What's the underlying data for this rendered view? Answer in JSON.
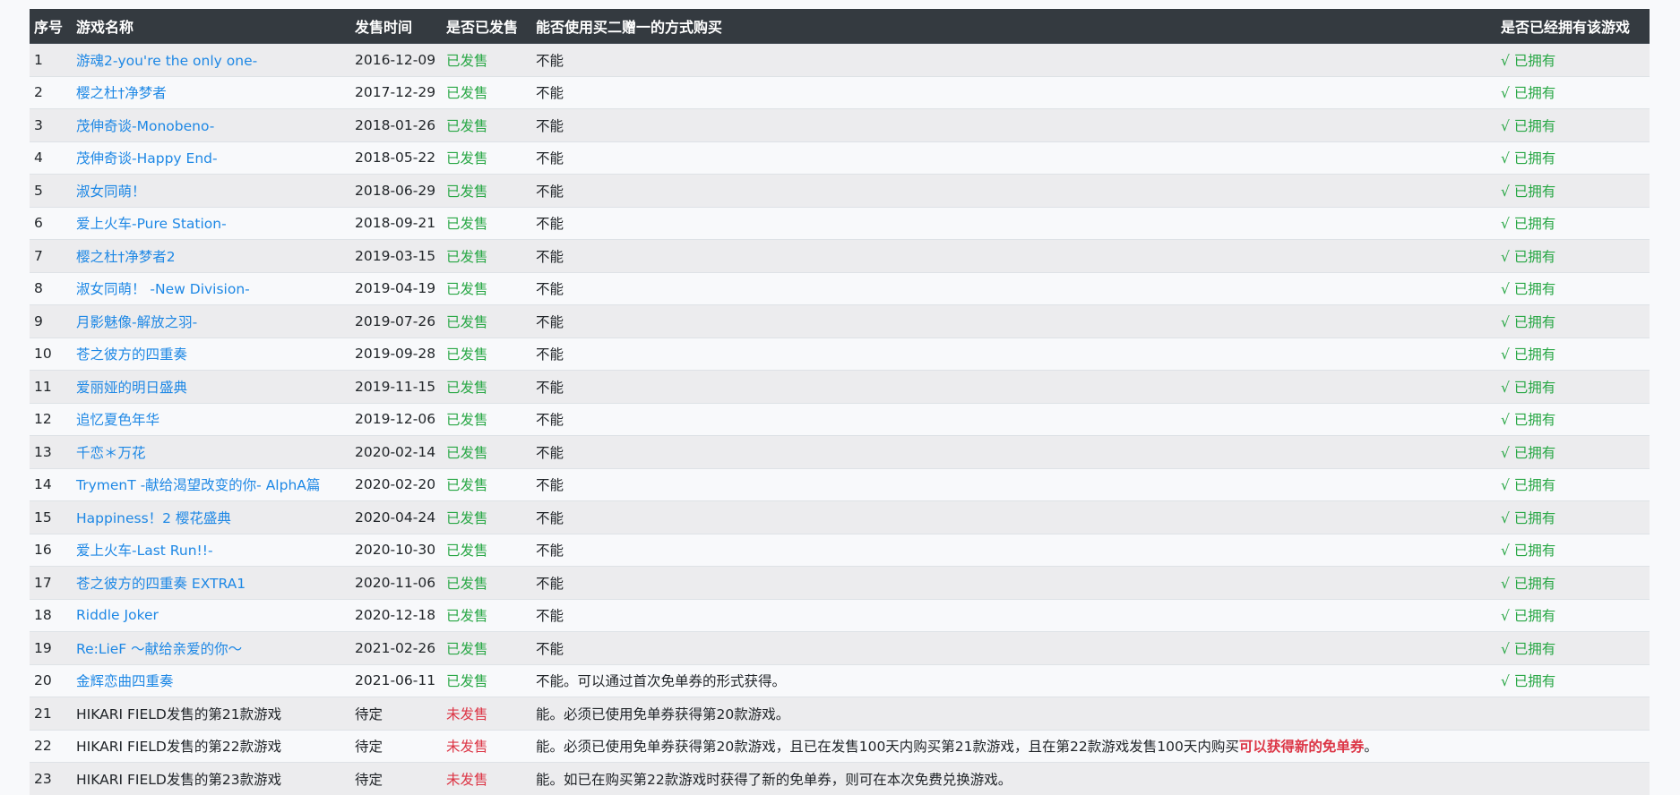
{
  "colors": {
    "header_bg": "#343a40",
    "link": "#1e88e5",
    "released": "#28a745",
    "unreleased": "#dc3545",
    "owned": "#28a745"
  },
  "table": {
    "headers": {
      "index": "序号",
      "name": "游戏名称",
      "date": "发售时间",
      "released": "是否已发售",
      "bogo": "能否使用买二赠一的方式购买",
      "owned": "是否已经拥有该游戏"
    },
    "rows": [
      {
        "index": "1",
        "name": "游魂2-you're the only one-",
        "link": true,
        "date": "2016-12-09",
        "status": "已发售",
        "released": true,
        "bogo": "不能",
        "owned": "√ 已拥有"
      },
      {
        "index": "2",
        "name": "樱之杜†净梦者",
        "link": true,
        "date": "2017-12-29",
        "status": "已发售",
        "released": true,
        "bogo": "不能",
        "owned": "√ 已拥有"
      },
      {
        "index": "3",
        "name": "茂伸奇谈-Monobeno-",
        "link": true,
        "date": "2018-01-26",
        "status": "已发售",
        "released": true,
        "bogo": "不能",
        "owned": "√ 已拥有"
      },
      {
        "index": "4",
        "name": "茂伸奇谈-Happy End-",
        "link": true,
        "date": "2018-05-22",
        "status": "已发售",
        "released": true,
        "bogo": "不能",
        "owned": "√ 已拥有"
      },
      {
        "index": "5",
        "name": "淑女同萌！",
        "link": true,
        "date": "2018-06-29",
        "status": "已发售",
        "released": true,
        "bogo": "不能",
        "owned": "√ 已拥有"
      },
      {
        "index": "6",
        "name": "爱上火车-Pure Station-",
        "link": true,
        "date": "2018-09-21",
        "status": "已发售",
        "released": true,
        "bogo": "不能",
        "owned": "√ 已拥有"
      },
      {
        "index": "7",
        "name": "樱之杜†净梦者2",
        "link": true,
        "date": "2019-03-15",
        "status": "已发售",
        "released": true,
        "bogo": "不能",
        "owned": "√ 已拥有"
      },
      {
        "index": "8",
        "name": "淑女同萌！ -New Division-",
        "link": true,
        "date": "2019-04-19",
        "status": "已发售",
        "released": true,
        "bogo": "不能",
        "owned": "√ 已拥有"
      },
      {
        "index": "9",
        "name": "月影魅像-解放之羽-",
        "link": true,
        "date": "2019-07-26",
        "status": "已发售",
        "released": true,
        "bogo": "不能",
        "owned": "√ 已拥有"
      },
      {
        "index": "10",
        "name": "苍之彼方的四重奏",
        "link": true,
        "date": "2019-09-28",
        "status": "已发售",
        "released": true,
        "bogo": "不能",
        "owned": "√ 已拥有"
      },
      {
        "index": "11",
        "name": "爱丽娅的明日盛典",
        "link": true,
        "date": "2019-11-15",
        "status": "已发售",
        "released": true,
        "bogo": "不能",
        "owned": "√ 已拥有"
      },
      {
        "index": "12",
        "name": "追忆夏色年华",
        "link": true,
        "date": "2019-12-06",
        "status": "已发售",
        "released": true,
        "bogo": "不能",
        "owned": "√ 已拥有"
      },
      {
        "index": "13",
        "name": "千恋＊万花",
        "link": true,
        "date": "2020-02-14",
        "status": "已发售",
        "released": true,
        "bogo": "不能",
        "owned": "√ 已拥有"
      },
      {
        "index": "14",
        "name": "TrymenT -献给渴望改变的你- AlphA篇",
        "link": true,
        "date": "2020-02-20",
        "status": "已发售",
        "released": true,
        "bogo": "不能",
        "owned": "√ 已拥有"
      },
      {
        "index": "15",
        "name": "Happiness！2 樱花盛典",
        "link": true,
        "date": "2020-04-24",
        "status": "已发售",
        "released": true,
        "bogo": "不能",
        "owned": "√ 已拥有"
      },
      {
        "index": "16",
        "name": "爱上火车-Last Run!!-",
        "link": true,
        "date": "2020-10-30",
        "status": "已发售",
        "released": true,
        "bogo": "不能",
        "owned": "√ 已拥有"
      },
      {
        "index": "17",
        "name": "苍之彼方的四重奏 EXTRA1",
        "link": true,
        "date": "2020-11-06",
        "status": "已发售",
        "released": true,
        "bogo": "不能",
        "owned": "√ 已拥有"
      },
      {
        "index": "18",
        "name": "Riddle Joker",
        "link": true,
        "date": "2020-12-18",
        "status": "已发售",
        "released": true,
        "bogo": "不能",
        "owned": "√ 已拥有"
      },
      {
        "index": "19",
        "name": "Re:LieF ～献给亲爱的你～",
        "link": true,
        "date": "2021-02-26",
        "status": "已发售",
        "released": true,
        "bogo": "不能",
        "owned": "√ 已拥有"
      },
      {
        "index": "20",
        "name": "金辉恋曲四重奏",
        "link": true,
        "date": "2021-06-11",
        "status": "已发售",
        "released": true,
        "bogo": "不能。可以通过首次免单券的形式获得。",
        "owned": "√ 已拥有"
      },
      {
        "index": "21",
        "name": "HIKARI FIELD发售的第21款游戏",
        "link": false,
        "date": "待定",
        "status": "未发售",
        "released": false,
        "bogo": "能。必须已使用免单券获得第20款游戏。",
        "owned": ""
      },
      {
        "index": "22",
        "name": "HIKARI FIELD发售的第22款游戏",
        "link": false,
        "date": "待定",
        "status": "未发售",
        "released": false,
        "bogo": "能。必须已使用免单券获得第20款游戏，且已在发售100天内购买第21款游戏，且在第22款游戏发售100天内购买",
        "bogo_highlight": "可以获得新的免单券",
        "bogo_tail": "。",
        "owned": ""
      },
      {
        "index": "23",
        "name": "HIKARI FIELD发售的第23款游戏",
        "link": false,
        "date": "待定",
        "status": "未发售",
        "released": false,
        "bogo": "能。如已在购买第22款游戏时获得了新的免单券，则可在本次免费兑换游戏。",
        "owned": ""
      }
    ]
  }
}
